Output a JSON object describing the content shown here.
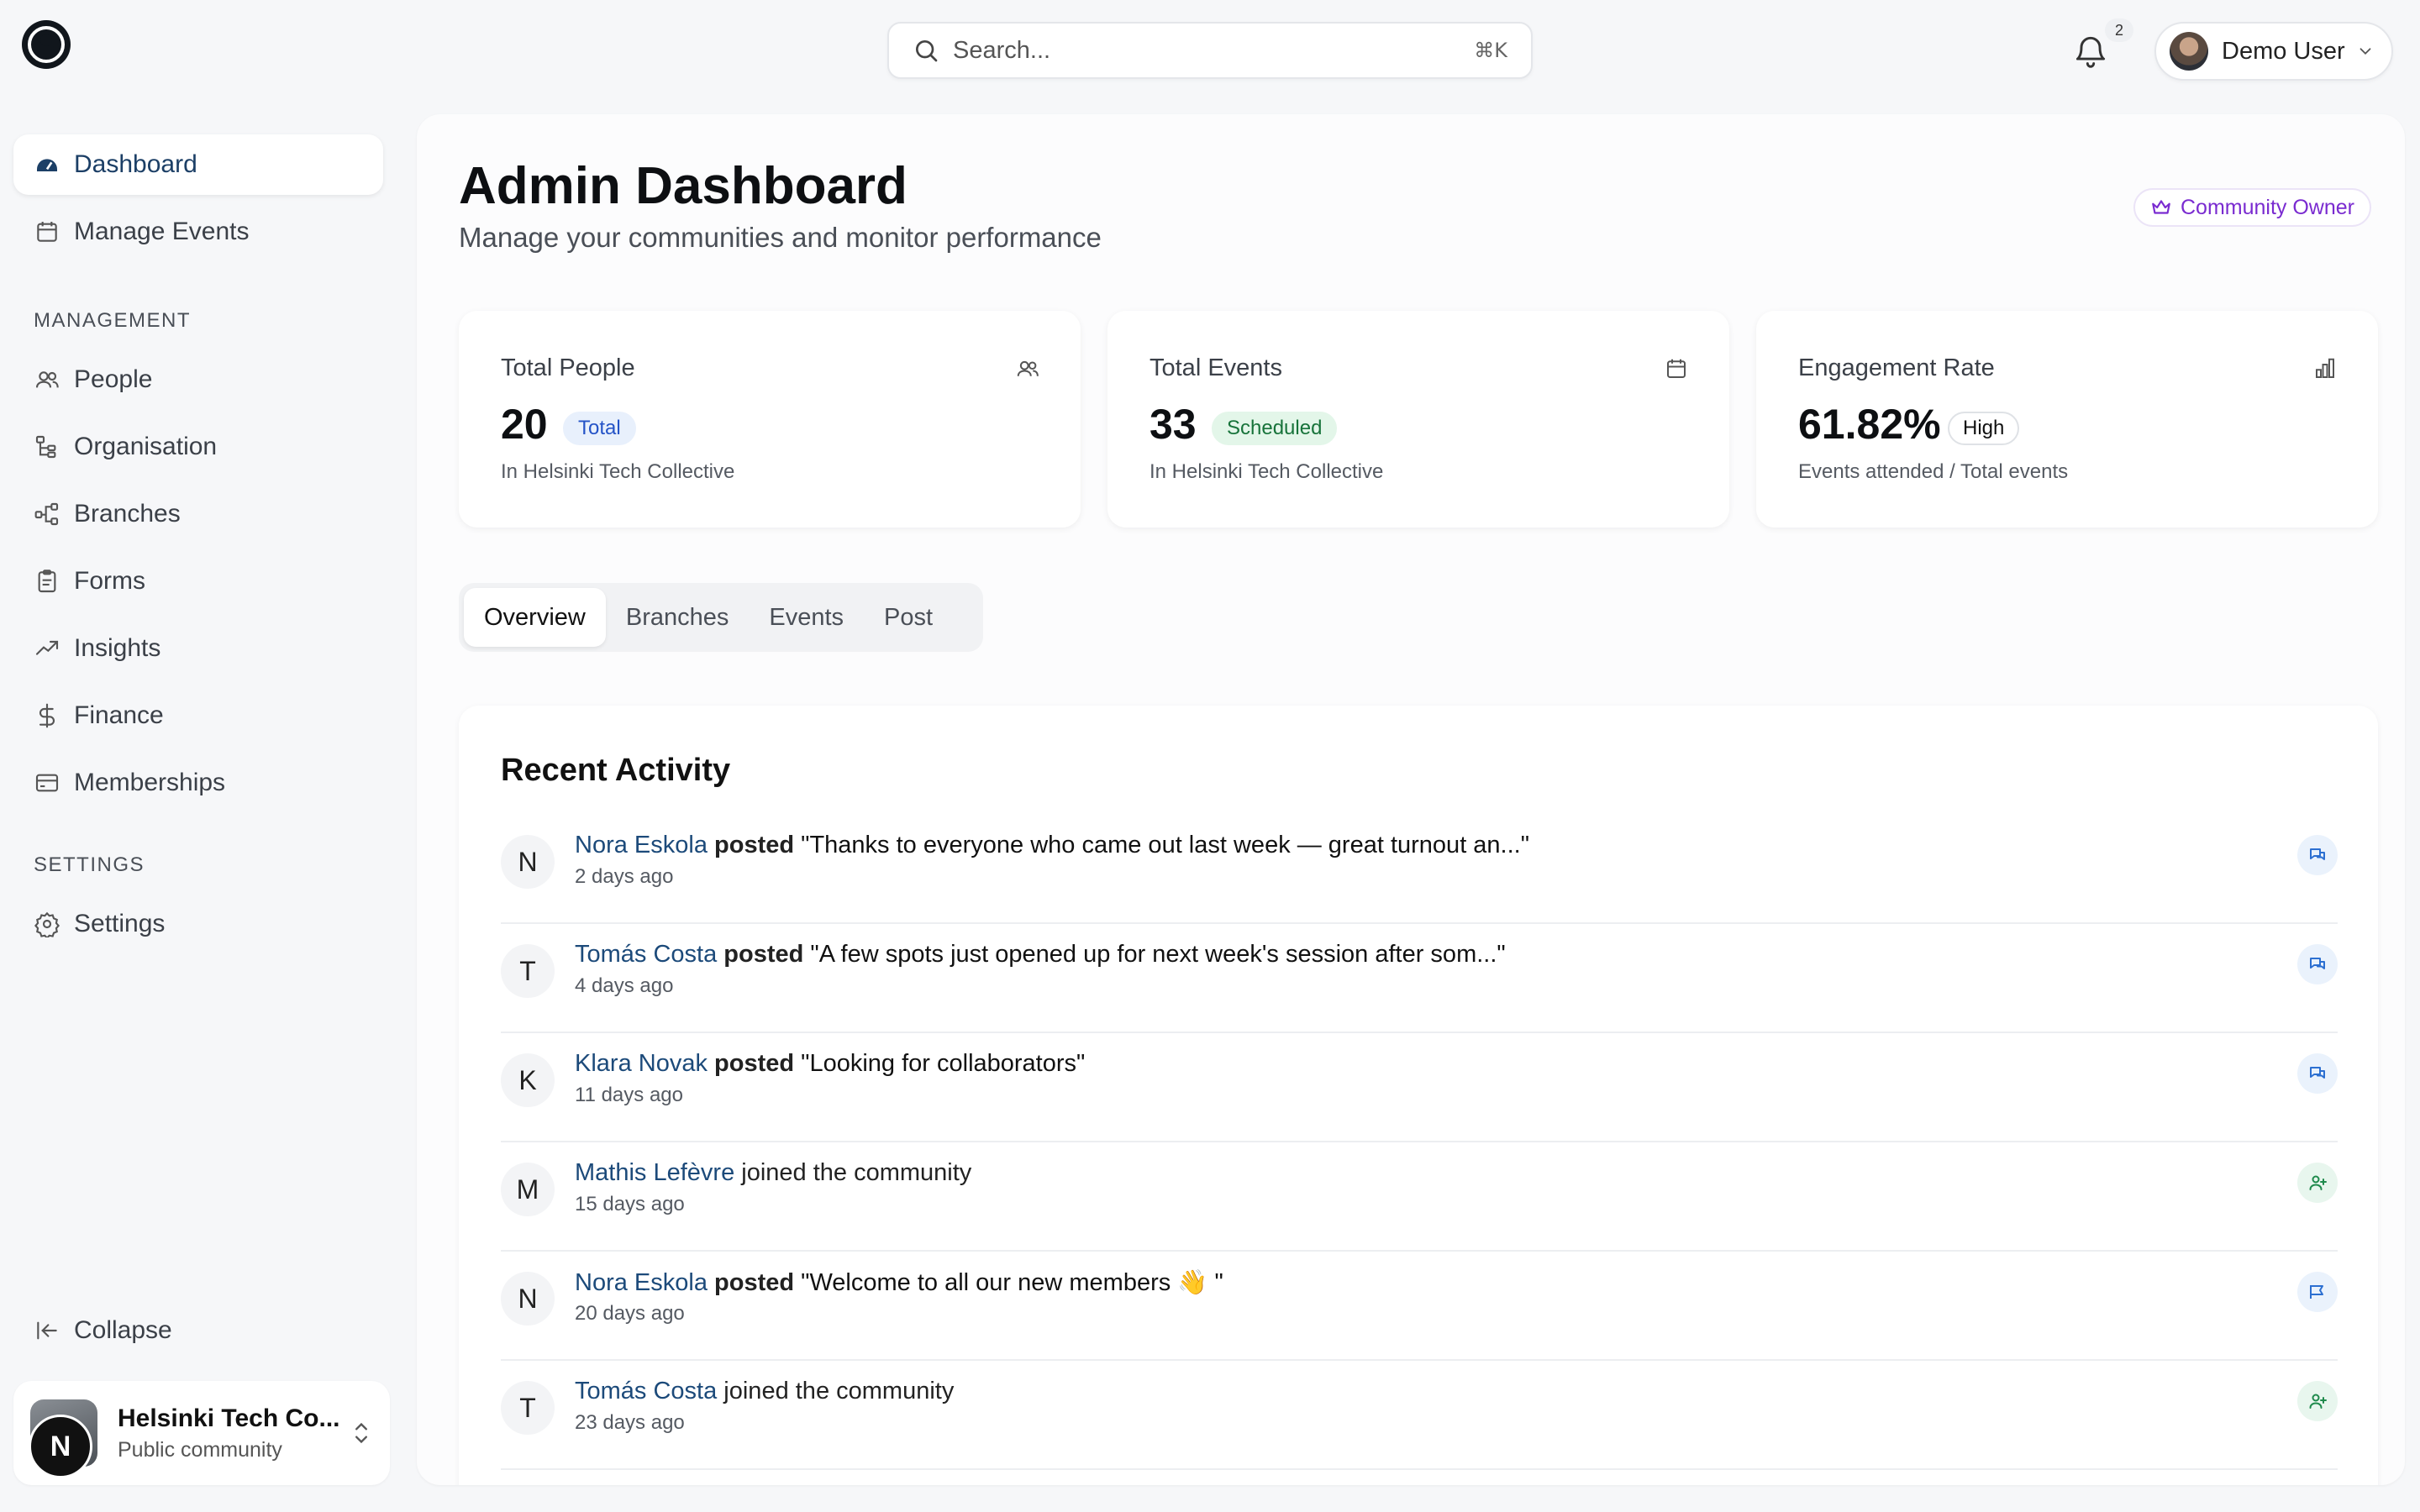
{
  "search": {
    "placeholder": "Search...",
    "shortcut": "⌘K"
  },
  "notifications": {
    "count": "2"
  },
  "user": {
    "name": "Demo User"
  },
  "sidebar": {
    "primary": [
      {
        "label": "Dashboard",
        "icon": "dashboard-icon",
        "active": true
      },
      {
        "label": "Manage Events",
        "icon": "calendar-icon"
      }
    ],
    "management_title": "MANAGEMENT",
    "management": [
      {
        "label": "People",
        "icon": "people-icon"
      },
      {
        "label": "Organisation",
        "icon": "organisation-icon"
      },
      {
        "label": "Branches",
        "icon": "branches-icon"
      },
      {
        "label": "Forms",
        "icon": "forms-icon"
      },
      {
        "label": "Insights",
        "icon": "trending-up-icon"
      },
      {
        "label": "Finance",
        "icon": "dollar-icon"
      },
      {
        "label": "Memberships",
        "icon": "card-icon"
      }
    ],
    "settings_title": "SETTINGS",
    "settings": [
      {
        "label": "Settings",
        "icon": "gear-icon"
      }
    ],
    "collapse_label": "Collapse",
    "community": {
      "name": "Helsinki Tech Co...",
      "type": "Public community",
      "initial": "N"
    }
  },
  "main": {
    "title": "Admin Dashboard",
    "subtitle": "Manage your communities and monitor performance",
    "role_badge": "Community Owner",
    "stats": [
      {
        "label": "Total People",
        "value": "20",
        "chip": "Total",
        "desc": "In Helsinki Tech Collective",
        "chip_bg": "#e8f0fc",
        "chip_color": "#2453c7",
        "chip_border": "#e8f0fc"
      },
      {
        "label": "Total Events",
        "value": "33",
        "chip": "Scheduled",
        "desc": "In Helsinki Tech Collective",
        "chip_bg": "#e3f6e9",
        "chip_color": "#17733a",
        "chip_border": "#e3f6e9"
      },
      {
        "label": "Engagement Rate",
        "value": "61.82%",
        "chip": "High",
        "desc": "Events attended / Total events",
        "chip_bg": "#ffffff",
        "chip_color": "#111111",
        "chip_border": "#dfe2e6"
      }
    ],
    "tabs": [
      "Overview",
      "Branches",
      "Events",
      "Post"
    ],
    "activity_title": "Recent Activity",
    "activity": [
      {
        "initial": "N",
        "who": "Nora Eskola",
        "verb": "posted",
        "text": "\"Thanks to everyone who came out last week — great turnout an...\"",
        "time": "2 days ago",
        "kind": "post"
      },
      {
        "initial": "T",
        "who": "Tomás Costa",
        "verb": "posted",
        "text": "\"A few spots just opened up for next week's session after som...\"",
        "time": "4 days ago",
        "kind": "post"
      },
      {
        "initial": "K",
        "who": "Klara Novak",
        "verb": "posted",
        "text": "\"Looking for collaborators\"",
        "time": "11 days ago",
        "kind": "post"
      },
      {
        "initial": "M",
        "who": "Mathis Lefèvre",
        "verb": "joined the community",
        "text": "",
        "time": "15 days ago",
        "kind": "join"
      },
      {
        "initial": "N",
        "who": "Nora Eskola",
        "verb": "posted",
        "text": "\"Welcome to all our new members 👋 \"",
        "time": "20 days ago",
        "kind": "announce"
      },
      {
        "initial": "T",
        "who": "Tomás Costa",
        "verb": "joined the community",
        "text": "",
        "time": "23 days ago",
        "kind": "join"
      }
    ]
  }
}
